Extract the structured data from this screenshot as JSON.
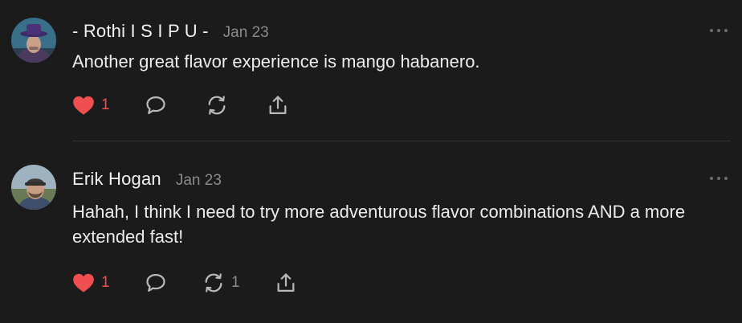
{
  "comments": [
    {
      "author": "- Rothi I S I P U -",
      "date": "Jan 23",
      "text": "Another great flavor experience is mango habanero.",
      "likes": "1",
      "restacks": ""
    },
    {
      "author": "Erik Hogan",
      "date": "Jan 23",
      "text": "Hahah, I think I need to try more adventurous flavor combinations AND a more extended fast!",
      "likes": "1",
      "restacks": "1"
    }
  ],
  "colors": {
    "background": "#1b1b1c",
    "heart": "#ef4f4f",
    "muted": "#8a8a8c",
    "icon": "#b9b9bb"
  },
  "icons": [
    "avatar",
    "more-icon",
    "heart-icon",
    "reply-icon",
    "restack-icon",
    "share-icon"
  ]
}
